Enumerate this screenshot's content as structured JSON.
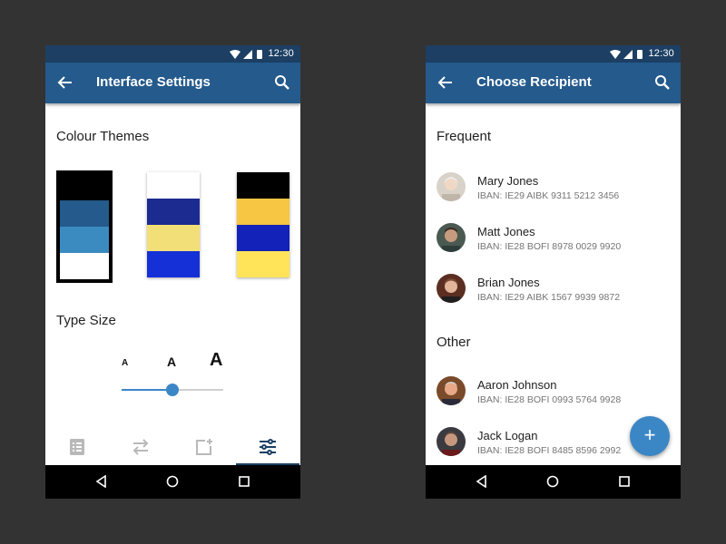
{
  "status_bar": {
    "time": "12:30"
  },
  "left_screen": {
    "title": "Interface Settings",
    "colour_themes_label": "Colour Themes",
    "themes": [
      {
        "name": "dark-blue",
        "colors": [
          "#000000",
          "#245a8c",
          "#3b8bc0",
          "#ffffff"
        ],
        "selected": true
      },
      {
        "name": "navy-yellow",
        "colors": [
          "#ffffff",
          "#1c2b8f",
          "#f3df77",
          "#1530d6"
        ],
        "selected": false
      },
      {
        "name": "black-yellow-blue",
        "colors": [
          "#000000",
          "#f7c642",
          "#1322b8",
          "#ffe45a"
        ],
        "selected": false
      }
    ],
    "type_size_label": "Type Size",
    "type_size_letters": [
      "A",
      "A",
      "A"
    ],
    "type_size_level": 0.5,
    "bottom_tabs": [
      "list-icon",
      "transfer-icon",
      "add-photo-icon",
      "sliders-icon"
    ],
    "active_tab": 3
  },
  "right_screen": {
    "title": "Choose Recipient",
    "frequent_label": "Frequent",
    "frequent": [
      {
        "name": "Mary Jones",
        "iban": "IBAN: IE29 AIBK 9311 5212 3456"
      },
      {
        "name": "Matt Jones",
        "iban": "IBAN: IE28 BOFI 8978 0029 9920"
      },
      {
        "name": "Brian Jones",
        "iban": "IBAN: IE29 AIBK 1567 9939 9872"
      }
    ],
    "other_label": "Other",
    "other": [
      {
        "name": "Aaron Johnson",
        "iban": "IBAN: IE28 BOFI 0993 5764 9928"
      },
      {
        "name": "Jack Logan",
        "iban": "IBAN: IE28 BOFI 8485 8596 2992"
      }
    ],
    "fab_label": "+"
  },
  "colors": {
    "background": "#333333",
    "status_bar": "#1c3f63",
    "app_bar": "#245a8c",
    "accent": "#3b87c6"
  }
}
